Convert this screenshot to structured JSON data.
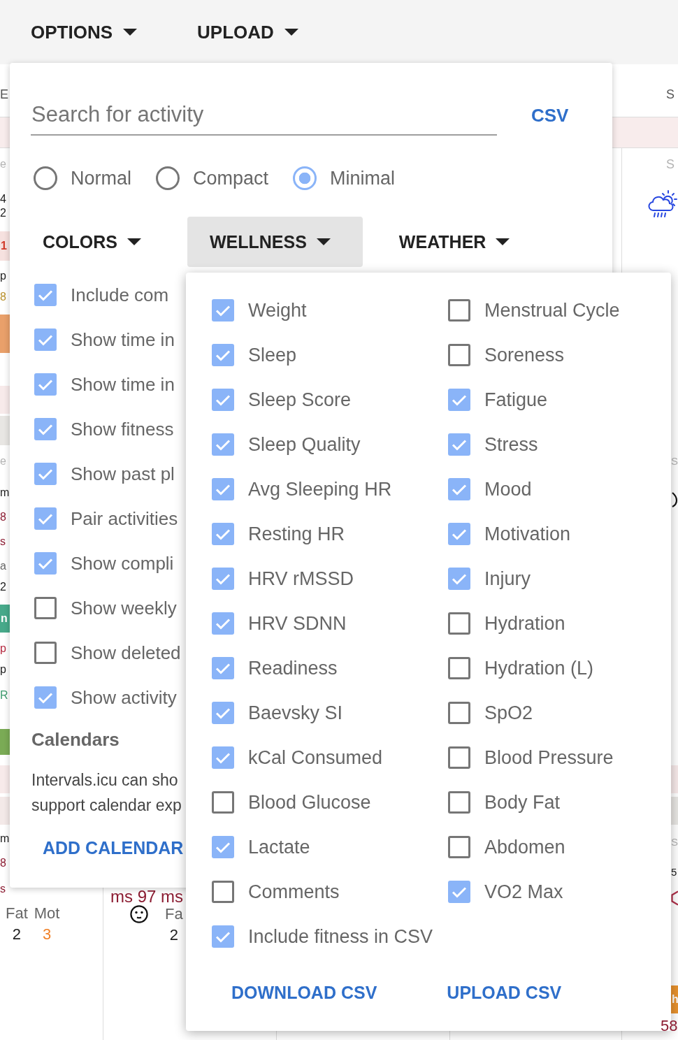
{
  "toolbar": {
    "buttons": [
      {
        "label": "OPTIONS"
      },
      {
        "label": "UPLOAD"
      }
    ]
  },
  "calendar": {
    "header": {
      "left": "E",
      "right": "S"
    },
    "left_column": [
      {
        "kind": "text",
        "text": "e",
        "color": "#b3b3b3"
      },
      {
        "kind": "text",
        "text": "4",
        "color": "#222222"
      },
      {
        "kind": "text",
        "text": "2",
        "color": "#222222"
      },
      {
        "kind": "band",
        "color": "#f6e1df",
        "text": "1"
      },
      {
        "kind": "text",
        "text": "p",
        "color": "#222222"
      },
      {
        "kind": "text",
        "text": "8",
        "color": "#b8902a"
      },
      {
        "kind": "block",
        "color": "#e9a06a"
      },
      {
        "kind": "band",
        "color": "#f7eaea"
      },
      {
        "kind": "band",
        "color": "#e8e6e3"
      },
      {
        "kind": "text",
        "text": "e",
        "color": "#b3b3b3"
      },
      {
        "kind": "text",
        "text": "m",
        "color": "#222222"
      },
      {
        "kind": "text",
        "text": "8",
        "color": "#8c1c32"
      },
      {
        "kind": "text",
        "text": "s",
        "color": "#8c1c32"
      },
      {
        "kind": "text",
        "text": "a",
        "color": "#666666"
      },
      {
        "kind": "text",
        "text": "2",
        "color": "#222222"
      },
      {
        "kind": "block",
        "color": "#47a98a",
        "text": "n"
      },
      {
        "kind": "text",
        "text": "p",
        "color": "#b5283f"
      },
      {
        "kind": "text",
        "text": "p",
        "color": "#222222"
      },
      {
        "kind": "text",
        "text": "R",
        "color": "#3c9a6c"
      },
      {
        "kind": "block",
        "color": "#7aab55"
      },
      {
        "kind": "band",
        "color": "#f7eaea"
      },
      {
        "kind": "band",
        "color": "#f3e9e8"
      },
      {
        "kind": "text",
        "text": "m",
        "color": "#222222"
      },
      {
        "kind": "text",
        "text": "8",
        "color": "#8c1c32"
      },
      {
        "kind": "text",
        "text": "s",
        "color": "#8c1c32"
      }
    ],
    "left_stats": [
      {
        "label": "Fat",
        "value": "2",
        "color": "#222222"
      },
      {
        "label": "Mot",
        "value": "3",
        "color": "#f0822a"
      }
    ],
    "second_column": {
      "reading": "ms 97 ms",
      "stats": [
        {
          "label": "Fa",
          "value": "2"
        }
      ]
    },
    "right_column": [
      {
        "kind": "text",
        "text": "S",
        "color": "#b3b3b3"
      },
      {
        "kind": "icon"
      },
      {
        "kind": "text",
        "text": "S",
        "color": "#b3b3b3"
      },
      {
        "kind": "icon"
      },
      {
        "kind": "band",
        "color": "#f7eaea"
      },
      {
        "kind": "band",
        "color": "#e8e6e3"
      },
      {
        "kind": "text",
        "text": "S",
        "color": "#b3b3b3"
      },
      {
        "kind": "text",
        "text": "5",
        "color": "#222222"
      },
      {
        "kind": "icon"
      },
      {
        "kind": "block",
        "color": "#e8922e",
        "text": "h"
      },
      {
        "kind": "text",
        "text": "58",
        "color": "#8c1c32"
      }
    ]
  },
  "options_menu": {
    "search": {
      "placeholder": "Search for activity"
    },
    "csv_link": "CSV",
    "view_modes": [
      {
        "label": "Normal",
        "selected": false
      },
      {
        "label": "Compact",
        "selected": false
      },
      {
        "label": "Minimal",
        "selected": true
      }
    ],
    "dropdowns": [
      {
        "label": "COLORS",
        "expanded": false
      },
      {
        "label": "WELLNESS",
        "expanded": true
      },
      {
        "label": "WEATHER",
        "expanded": false
      }
    ],
    "settings": [
      {
        "label": "Include com",
        "checked": true
      },
      {
        "label": "Show time in",
        "checked": true
      },
      {
        "label": "Show time in",
        "checked": true
      },
      {
        "label": "Show fitness",
        "checked": true
      },
      {
        "label": "Show past pl",
        "checked": true
      },
      {
        "label": "Pair activities",
        "checked": true
      },
      {
        "label": "Show compli",
        "checked": true
      },
      {
        "label": "Show weekly",
        "checked": false
      },
      {
        "label": "Show deleted",
        "checked": false
      },
      {
        "label": "Show activity",
        "checked": true
      }
    ],
    "calendars": {
      "title": "Calendars",
      "lines": [
        "Intervals.icu can sho",
        "support calendar exp"
      ],
      "button": "ADD CALENDAR"
    }
  },
  "wellness_menu": {
    "fields": [
      {
        "label": "Weight",
        "checked": true
      },
      {
        "label": "Menstrual Cycle",
        "checked": false
      },
      {
        "label": "Sleep",
        "checked": true
      },
      {
        "label": "Soreness",
        "checked": false
      },
      {
        "label": "Sleep Score",
        "checked": true
      },
      {
        "label": "Fatigue",
        "checked": true
      },
      {
        "label": "Sleep Quality",
        "checked": true
      },
      {
        "label": "Stress",
        "checked": true
      },
      {
        "label": "Avg Sleeping HR",
        "checked": true
      },
      {
        "label": "Mood",
        "checked": true
      },
      {
        "label": "Resting HR",
        "checked": true
      },
      {
        "label": "Motivation",
        "checked": true
      },
      {
        "label": "HRV rMSSD",
        "checked": true
      },
      {
        "label": "Injury",
        "checked": true
      },
      {
        "label": "HRV SDNN",
        "checked": true
      },
      {
        "label": "Hydration",
        "checked": false
      },
      {
        "label": "Readiness",
        "checked": true
      },
      {
        "label": "Hydration (L)",
        "checked": false
      },
      {
        "label": "Baevsky SI",
        "checked": true
      },
      {
        "label": "SpO2",
        "checked": false
      },
      {
        "label": "kCal Consumed",
        "checked": true
      },
      {
        "label": "Blood Pressure",
        "checked": false
      },
      {
        "label": "Blood Glucose",
        "checked": false
      },
      {
        "label": "Body Fat",
        "checked": false
      },
      {
        "label": "Lactate",
        "checked": true
      },
      {
        "label": "Abdomen",
        "checked": false
      },
      {
        "label": "Comments",
        "checked": false
      },
      {
        "label": "VO2 Max",
        "checked": true
      }
    ],
    "include_fitness": {
      "label": "Include fitness in CSV",
      "checked": true
    },
    "buttons": [
      "DOWNLOAD CSV",
      "UPLOAD CSV"
    ]
  }
}
